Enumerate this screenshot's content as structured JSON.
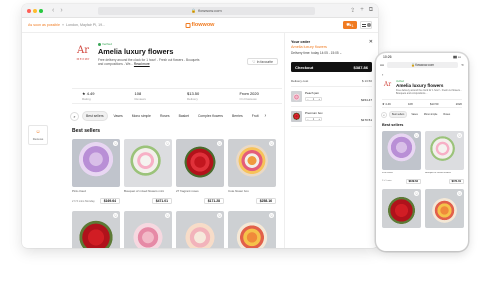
{
  "browser": {
    "url": "flowwow.com",
    "dot_colors": [
      "#ff5f57",
      "#febc2e",
      "#28c840"
    ]
  },
  "header": {
    "location_prefix": "As soon as possible",
    "location": "London, Mayfair PI, 19...",
    "logo": "flowwow",
    "cart_count": "1"
  },
  "shop": {
    "logo_text": "Ar",
    "logo_sub": "МЕЛИР",
    "verified": "Verified",
    "name": "Amelia luxury flowers",
    "description": "Free delivery around the clock for 1 hour! - Fresh cut flowers - Bouquets and compositions - We...",
    "more": "Read more",
    "favourite": "In favourite",
    "side_favourite": "Reviews",
    "stats": [
      {
        "value": "★ 4.49",
        "label": "Rating"
      },
      {
        "value": "108",
        "label": "Reviews"
      },
      {
        "value": "$13.50",
        "label": "Delivery"
      },
      {
        "value": "From 2020",
        "label": "On Flowwow"
      }
    ]
  },
  "tabs": [
    "Best sellers",
    "Vases",
    "Mono simple",
    "Roses",
    "Basket",
    "Complex flowers",
    "Berries",
    "Fruit"
  ],
  "section_title": "Best sellers",
  "products": [
    {
      "name": "Pink cloud",
      "time": "2 h 5 mins Monday",
      "price": "$169.64",
      "img": "f-lilac"
    },
    {
      "name": "Bouquet of mixed flowers mini",
      "time": "",
      "price": "$471.01",
      "img": "f-white"
    },
    {
      "name": "27 fragrant roses",
      "time": "",
      "price": "$171.28",
      "img": "f-red"
    },
    {
      "name": "Cute flower box",
      "time": "",
      "price": "$258.16",
      "img": "f-mix"
    },
    {
      "name": "",
      "time": "",
      "price": "",
      "img": "f-red2"
    },
    {
      "name": "",
      "time": "",
      "price": "",
      "img": "f-pink"
    },
    {
      "name": "",
      "time": "",
      "price": "",
      "img": "f-peach"
    },
    {
      "name": "",
      "time": "",
      "price": "",
      "img": "f-orange"
    }
  ],
  "cart": {
    "title": "Your order",
    "shop": "Amelia luxury flowers",
    "delivery_time": "Delivery time: today 14:05 - 15:05 ⌄",
    "checkout_label": "Checkout",
    "checkout_total": "$387.86",
    "delivery_cost_label": "Delivery cost",
    "delivery_cost": "$ 13.50",
    "items": [
      {
        "name": "Peach jam",
        "qty": "1",
        "price": "$154.47",
        "img": "f-pink"
      },
      {
        "name": "Premium box",
        "qty": "1",
        "price": "$170.51",
        "img": "f-red"
      }
    ]
  },
  "phone": {
    "time": "10:26",
    "url": "flowwow.com",
    "aa": "AA",
    "shop_name": "Amelia luxury flowers",
    "verified": "Verified",
    "description": "Free delivery around the clock for 1 hour! - Fresh cut flowers - Bouquets and compositions...",
    "stats": [
      "★ 4.49",
      "108",
      "$13.50",
      "2020"
    ],
    "tabs": [
      "Best sellers",
      "Vases",
      "Mono simple",
      "Roses"
    ],
    "section_title": "Best sellers",
    "products": [
      {
        "name": "Pink cloud",
        "time": "2 h 5 mins",
        "price": "$169.64",
        "img": "f-lilac"
      },
      {
        "name": "Bouquet of mixed flowers",
        "time": "",
        "price": "$471.01",
        "img": "f-white"
      },
      {
        "name": "",
        "time": "",
        "price": "",
        "img": "f-red2"
      },
      {
        "name": "",
        "time": "",
        "price": "",
        "img": "f-orange"
      }
    ]
  },
  "colors": {
    "accent": "#f07b21",
    "brand_red": "#d0443b",
    "verified": "#3aa657"
  }
}
